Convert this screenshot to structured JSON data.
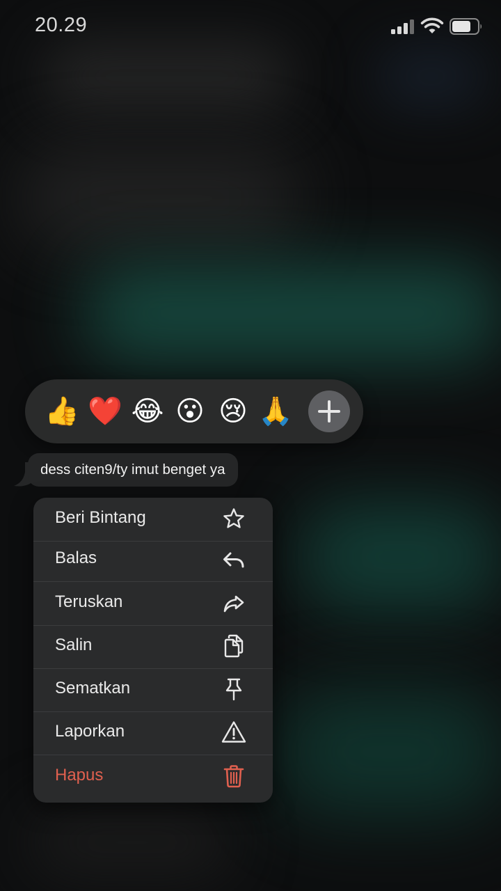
{
  "status_bar": {
    "time": "20.29"
  },
  "reactions": {
    "emojis": [
      {
        "glyph": "👍",
        "icon": "thumbs-up-icon"
      },
      {
        "glyph": "❤️",
        "icon": "heart-icon"
      },
      {
        "glyph": "😂",
        "icon": "tears-of-joy-icon"
      },
      {
        "glyph": "😮",
        "icon": "surprised-face-icon"
      },
      {
        "glyph": "😢",
        "icon": "crying-face-icon"
      },
      {
        "glyph": "🙏",
        "icon": "folded-hands-icon"
      }
    ],
    "more_icon": "plus-icon"
  },
  "message": {
    "text": "dess citen9/ty imut benget ya"
  },
  "menu": {
    "items": [
      {
        "label": "Beri Bintang",
        "icon": "star-icon"
      },
      {
        "label": "Balas",
        "icon": "reply-icon"
      },
      {
        "label": "Teruskan",
        "icon": "forward-icon"
      },
      {
        "label": "Salin",
        "icon": "copy-icon"
      },
      {
        "label": "Sematkan",
        "icon": "pin-icon"
      },
      {
        "label": "Laporkan",
        "icon": "warning-icon"
      },
      {
        "label": "Hapus",
        "icon": "trash-icon"
      }
    ]
  },
  "colors": {
    "destructive": "#e0604f",
    "menu_background": "#2a2b2c",
    "bubble_background": "#252627"
  }
}
